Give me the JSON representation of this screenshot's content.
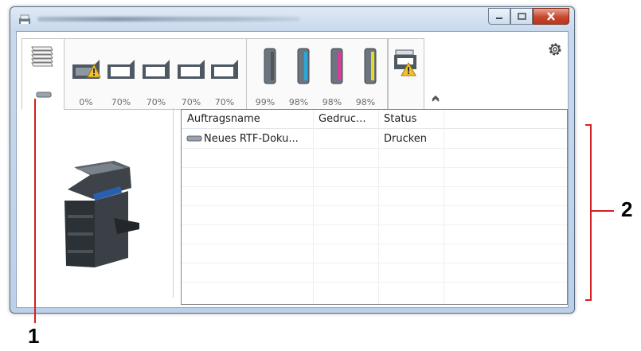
{
  "window": {
    "title_obscured": true
  },
  "toolbar": {
    "trays": [
      "0%",
      "70%",
      "70%",
      "70%",
      "70%"
    ],
    "toners": [
      {
        "percent": "99%",
        "color": "#555555"
      },
      {
        "percent": "98%",
        "color": "#2aa8d8"
      },
      {
        "percent": "98%",
        "color": "#d83c9a"
      },
      {
        "percent": "98%",
        "color": "#e6d72a"
      }
    ]
  },
  "joblist": {
    "columns": [
      "Auftragsname",
      "Gedruc...",
      "Status"
    ],
    "rows": [
      {
        "name": "Neues RTF-Doku...",
        "printed": "",
        "status": "Drucken"
      }
    ]
  },
  "callouts": {
    "one": "1",
    "two": "2"
  }
}
